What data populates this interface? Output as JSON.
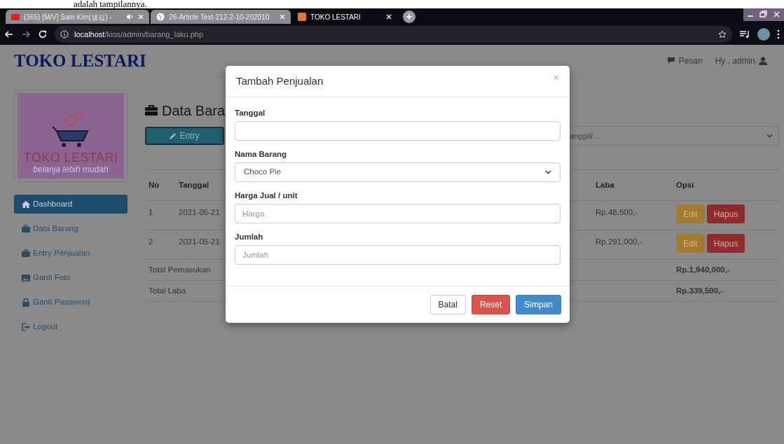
{
  "document_text": "adalah tampilannya.",
  "browser": {
    "tabs": [
      {
        "title": "(365) [M/V] Sam Kim(샘김) -",
        "kind": "video",
        "playing_audio": true,
        "selected": false
      },
      {
        "title": "26-Article Text-212-2-10-202010",
        "kind": "web",
        "playing_audio": false,
        "selected": false
      },
      {
        "title": "TOKO LESTARI",
        "kind": "app",
        "playing_audio": false,
        "selected": true
      }
    ],
    "url_host": "localhost",
    "url_path": "/kios/admin/barang_laku.php"
  },
  "header": {
    "brand": "TOKO LESTARI",
    "links": [
      {
        "kind": "message",
        "label": "Pesan"
      },
      {
        "kind": "user",
        "label": "Hy , admin"
      }
    ]
  },
  "sidebar": {
    "logo": {
      "title": "TOKO LESTARI",
      "tagline": "belanja lebih mudah"
    },
    "items": [
      {
        "label": "Dashboard",
        "kind": "home",
        "selected": true
      },
      {
        "label": "Data Barang",
        "kind": "briefcase",
        "selected": false
      },
      {
        "label": "Entry Penjualan",
        "kind": "briefcase",
        "selected": false
      },
      {
        "label": "Ganti Foto",
        "kind": "picture",
        "selected": false
      },
      {
        "label": "Ganti Password",
        "kind": "lock",
        "selected": false
      },
      {
        "label": "Logout",
        "kind": "logout",
        "selected": false
      }
    ]
  },
  "main": {
    "heading": "Data Bara",
    "entry_button": "Entry",
    "filter_select": "anggal ..",
    "table": {
      "columns_left": [
        "No",
        "Tanggal"
      ],
      "columns_right": [
        "Laba",
        "Opsi"
      ],
      "rows": [
        {
          "no": "1",
          "date": "2021-05-21",
          "laba": "Rp.48,500,-",
          "actions": [
            {
              "label": "Edit",
              "kind": "warning"
            },
            {
              "label": "Hapus",
              "kind": "danger"
            }
          ]
        },
        {
          "no": "2",
          "date": "2021-05-21",
          "laba": "Rp.291,000,-",
          "actions": [
            {
              "label": "Edit",
              "kind": "warning"
            },
            {
              "label": "Hapus",
              "kind": "danger"
            }
          ]
        }
      ],
      "totals": [
        {
          "label": "Total Pemasukan",
          "value": "Rp.1,940,000,-"
        },
        {
          "label": "Total Laba",
          "value": "Rp.339,500,-"
        }
      ]
    }
  },
  "modal": {
    "title": "Tambah Penjualan",
    "fields": [
      {
        "label": "Tanggal",
        "kind": "input"
      },
      {
        "label": "Nama Barang",
        "kind": "select",
        "value": "Choco Pie"
      },
      {
        "label": "Harga Jual / unit",
        "kind": "input",
        "placeholder": "Harga"
      },
      {
        "label": "Jumlah",
        "kind": "input",
        "placeholder": "Jumlah"
      }
    ],
    "buttons": [
      {
        "label": "Batal",
        "kind": "default"
      },
      {
        "label": "Reset",
        "kind": "danger"
      },
      {
        "label": "Simpan",
        "kind": "primary"
      }
    ]
  }
}
